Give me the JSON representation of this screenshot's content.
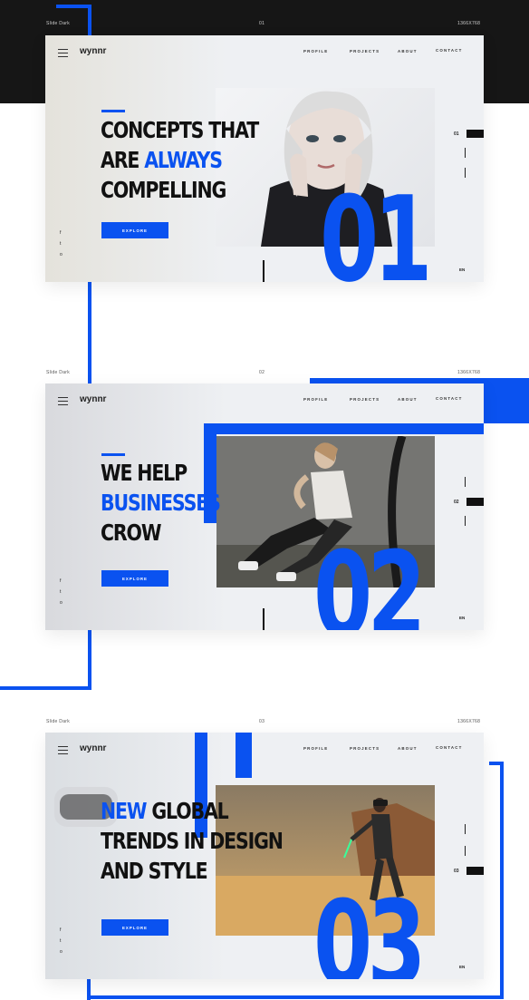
{
  "colors": {
    "accent": "#0a52f0",
    "dark_band": "#161616",
    "slide_bg": "#eef0f3"
  },
  "slides": [
    {
      "meta": {
        "label": "Slide Dark",
        "number": "01",
        "size": "1366X768"
      },
      "brand": "wynnr",
      "nav": [
        "PROFILE",
        "PROJECTS",
        "ABOUT",
        "CONTACT"
      ],
      "headline": {
        "line1": "CONCEPTS THAT",
        "line2_a": "ARE ",
        "line2_b": "ALWAYS",
        "line3": "COMPELLING"
      },
      "button": "EXPLORE",
      "social": [
        "f",
        "t",
        "o"
      ],
      "big_number": "01",
      "index": "01",
      "lang": "EN"
    },
    {
      "meta": {
        "label": "Slide Dark",
        "number": "02",
        "size": "1366X768"
      },
      "brand": "wynnr",
      "nav": [
        "PROFILE",
        "PROJECTS",
        "ABOUT",
        "CONTACT"
      ],
      "headline": {
        "line1": "WE HELP",
        "line2": "BUSINESSES",
        "line3": "CROW"
      },
      "button": "EXPLORE",
      "social": [
        "f",
        "t",
        "o"
      ],
      "big_number": "02",
      "index": "02",
      "lang": "EN"
    },
    {
      "meta": {
        "label": "Slide Dark",
        "number": "03",
        "size": "1366X768"
      },
      "brand": "wynnr",
      "nav": [
        "PROFILE",
        "PROJECTS",
        "ABOUT",
        "CONTACT"
      ],
      "headline": {
        "line1_a": "NEW",
        "line1_b": " GLOBAL",
        "line2": "TRENDS IN DESIGN",
        "line3": "AND STYLE"
      },
      "button": "EXPLORE",
      "social": [
        "f",
        "t",
        "o"
      ],
      "big_number": "03",
      "index": "03",
      "lang": "EN"
    }
  ]
}
